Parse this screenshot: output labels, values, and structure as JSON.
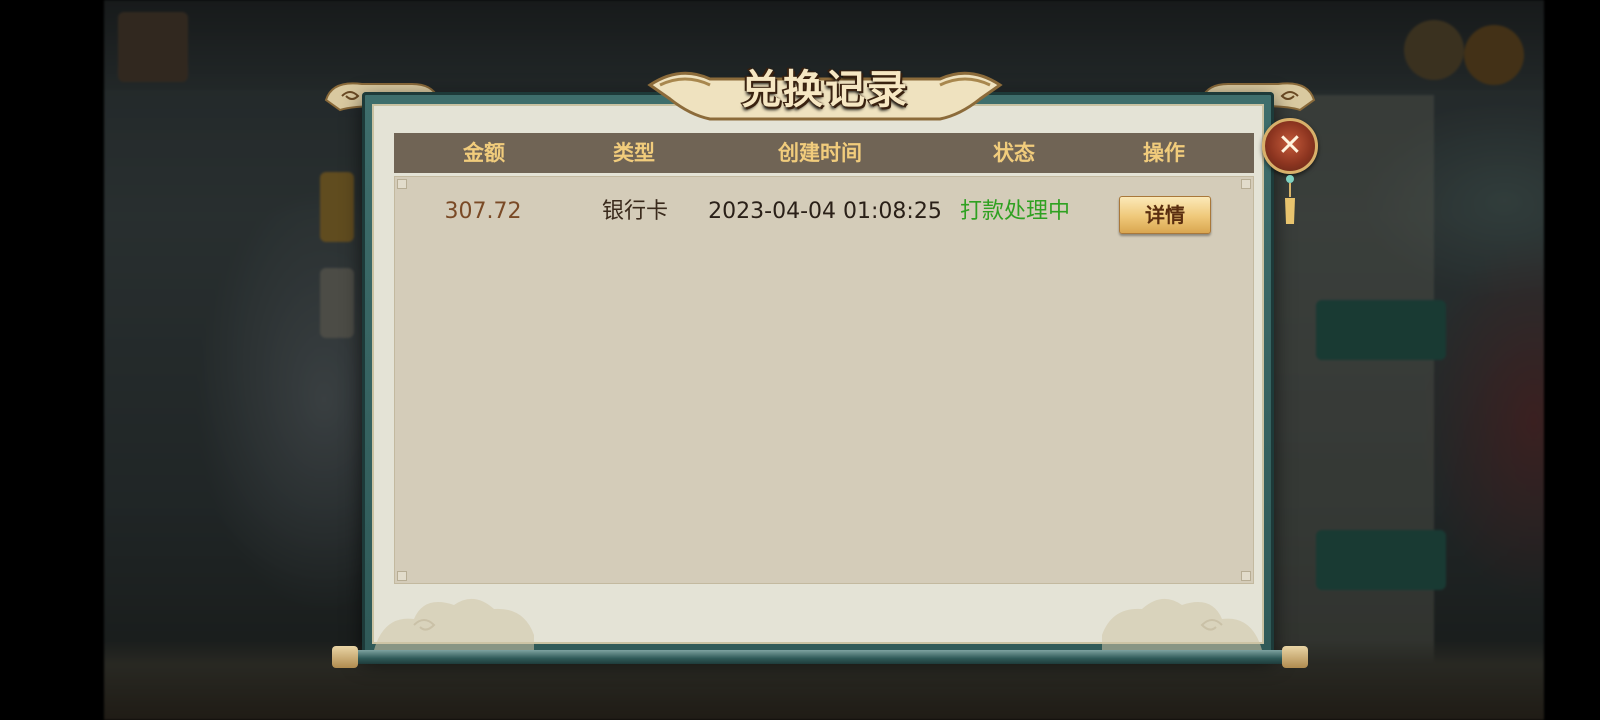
{
  "dialog": {
    "title": "兑换记录",
    "close_label": "✕"
  },
  "table": {
    "columns": [
      "金额",
      "类型",
      "创建时间",
      "状态",
      "操作"
    ],
    "rows": [
      {
        "amount": "307.72",
        "type": "银行卡",
        "created_time": "2023-04-04 01:08:25",
        "status": "打款处理中",
        "action_label": "详情"
      }
    ]
  },
  "colors": {
    "header_bg": "#706455",
    "header_text": "#f1cc7c",
    "status_processing": "#2fa121",
    "amount_text": "#7a4a26",
    "frame_teal": "#3e6e6c"
  }
}
